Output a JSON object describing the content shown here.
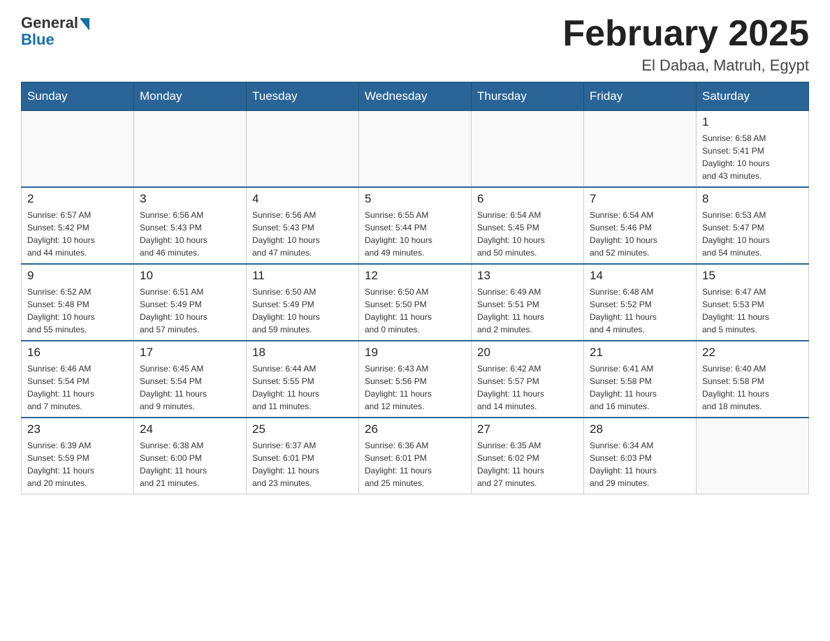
{
  "logo": {
    "general": "General",
    "blue": "Blue"
  },
  "title": "February 2025",
  "subtitle": "El Dabaa, Matruh, Egypt",
  "days_of_week": [
    "Sunday",
    "Monday",
    "Tuesday",
    "Wednesday",
    "Thursday",
    "Friday",
    "Saturday"
  ],
  "weeks": [
    [
      {
        "day": "",
        "info": ""
      },
      {
        "day": "",
        "info": ""
      },
      {
        "day": "",
        "info": ""
      },
      {
        "day": "",
        "info": ""
      },
      {
        "day": "",
        "info": ""
      },
      {
        "day": "",
        "info": ""
      },
      {
        "day": "1",
        "info": "Sunrise: 6:58 AM\nSunset: 5:41 PM\nDaylight: 10 hours\nand 43 minutes."
      }
    ],
    [
      {
        "day": "2",
        "info": "Sunrise: 6:57 AM\nSunset: 5:42 PM\nDaylight: 10 hours\nand 44 minutes."
      },
      {
        "day": "3",
        "info": "Sunrise: 6:56 AM\nSunset: 5:43 PM\nDaylight: 10 hours\nand 46 minutes."
      },
      {
        "day": "4",
        "info": "Sunrise: 6:56 AM\nSunset: 5:43 PM\nDaylight: 10 hours\nand 47 minutes."
      },
      {
        "day": "5",
        "info": "Sunrise: 6:55 AM\nSunset: 5:44 PM\nDaylight: 10 hours\nand 49 minutes."
      },
      {
        "day": "6",
        "info": "Sunrise: 6:54 AM\nSunset: 5:45 PM\nDaylight: 10 hours\nand 50 minutes."
      },
      {
        "day": "7",
        "info": "Sunrise: 6:54 AM\nSunset: 5:46 PM\nDaylight: 10 hours\nand 52 minutes."
      },
      {
        "day": "8",
        "info": "Sunrise: 6:53 AM\nSunset: 5:47 PM\nDaylight: 10 hours\nand 54 minutes."
      }
    ],
    [
      {
        "day": "9",
        "info": "Sunrise: 6:52 AM\nSunset: 5:48 PM\nDaylight: 10 hours\nand 55 minutes."
      },
      {
        "day": "10",
        "info": "Sunrise: 6:51 AM\nSunset: 5:49 PM\nDaylight: 10 hours\nand 57 minutes."
      },
      {
        "day": "11",
        "info": "Sunrise: 6:50 AM\nSunset: 5:49 PM\nDaylight: 10 hours\nand 59 minutes."
      },
      {
        "day": "12",
        "info": "Sunrise: 6:50 AM\nSunset: 5:50 PM\nDaylight: 11 hours\nand 0 minutes."
      },
      {
        "day": "13",
        "info": "Sunrise: 6:49 AM\nSunset: 5:51 PM\nDaylight: 11 hours\nand 2 minutes."
      },
      {
        "day": "14",
        "info": "Sunrise: 6:48 AM\nSunset: 5:52 PM\nDaylight: 11 hours\nand 4 minutes."
      },
      {
        "day": "15",
        "info": "Sunrise: 6:47 AM\nSunset: 5:53 PM\nDaylight: 11 hours\nand 5 minutes."
      }
    ],
    [
      {
        "day": "16",
        "info": "Sunrise: 6:46 AM\nSunset: 5:54 PM\nDaylight: 11 hours\nand 7 minutes."
      },
      {
        "day": "17",
        "info": "Sunrise: 6:45 AM\nSunset: 5:54 PM\nDaylight: 11 hours\nand 9 minutes."
      },
      {
        "day": "18",
        "info": "Sunrise: 6:44 AM\nSunset: 5:55 PM\nDaylight: 11 hours\nand 11 minutes."
      },
      {
        "day": "19",
        "info": "Sunrise: 6:43 AM\nSunset: 5:56 PM\nDaylight: 11 hours\nand 12 minutes."
      },
      {
        "day": "20",
        "info": "Sunrise: 6:42 AM\nSunset: 5:57 PM\nDaylight: 11 hours\nand 14 minutes."
      },
      {
        "day": "21",
        "info": "Sunrise: 6:41 AM\nSunset: 5:58 PM\nDaylight: 11 hours\nand 16 minutes."
      },
      {
        "day": "22",
        "info": "Sunrise: 6:40 AM\nSunset: 5:58 PM\nDaylight: 11 hours\nand 18 minutes."
      }
    ],
    [
      {
        "day": "23",
        "info": "Sunrise: 6:39 AM\nSunset: 5:59 PM\nDaylight: 11 hours\nand 20 minutes."
      },
      {
        "day": "24",
        "info": "Sunrise: 6:38 AM\nSunset: 6:00 PM\nDaylight: 11 hours\nand 21 minutes."
      },
      {
        "day": "25",
        "info": "Sunrise: 6:37 AM\nSunset: 6:01 PM\nDaylight: 11 hours\nand 23 minutes."
      },
      {
        "day": "26",
        "info": "Sunrise: 6:36 AM\nSunset: 6:01 PM\nDaylight: 11 hours\nand 25 minutes."
      },
      {
        "day": "27",
        "info": "Sunrise: 6:35 AM\nSunset: 6:02 PM\nDaylight: 11 hours\nand 27 minutes."
      },
      {
        "day": "28",
        "info": "Sunrise: 6:34 AM\nSunset: 6:03 PM\nDaylight: 11 hours\nand 29 minutes."
      },
      {
        "day": "",
        "info": ""
      }
    ]
  ],
  "colors": {
    "header_bg": "#2a6496",
    "header_text": "#ffffff",
    "border": "#cccccc",
    "accent": "#2a6496"
  }
}
